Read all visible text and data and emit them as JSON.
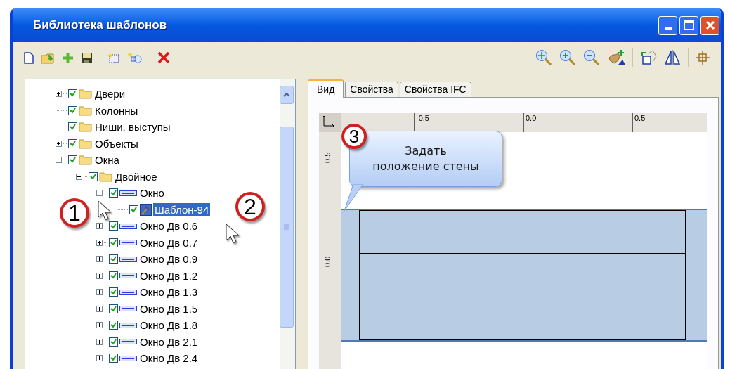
{
  "window": {
    "title": "Библиотека шаблонов"
  },
  "tree": [
    {
      "label": "Двери",
      "kind": "folder",
      "checked": true,
      "expanded": false,
      "selected": false
    },
    {
      "label": "Колонны",
      "kind": "folder",
      "checked": true,
      "selected": false
    },
    {
      "label": "Ниши, выступы",
      "kind": "folder",
      "checked": true,
      "selected": false
    },
    {
      "label": "Объекты",
      "kind": "folder",
      "checked": true,
      "expanded": false,
      "selected": false
    },
    {
      "label": "Окна",
      "kind": "folder",
      "checked": true,
      "expanded": true,
      "selected": false,
      "children": [
        {
          "label": "Двойное",
          "kind": "folder",
          "checked": true,
          "expanded": true,
          "selected": false,
          "children": [
            {
              "label": "Окно",
              "kind": "window",
              "checked": true,
              "expanded": true,
              "selected": false,
              "children": [
                {
                  "label": "Шаблон-94",
                  "kind": "template",
                  "checked": true,
                  "selected": true
                }
              ]
            },
            {
              "label": "Окно Дв 0.6",
              "kind": "window",
              "checked": true,
              "expanded": false,
              "selected": false
            },
            {
              "label": "Окно Дв 0.7",
              "kind": "window",
              "checked": true,
              "expanded": false,
              "selected": false
            },
            {
              "label": "Окно Дв 0.9",
              "kind": "window",
              "checked": true,
              "expanded": false,
              "selected": false
            },
            {
              "label": "Окно Дв 1.2",
              "kind": "window",
              "checked": true,
              "expanded": false,
              "selected": false
            },
            {
              "label": "Окно Дв 1.3",
              "kind": "window",
              "checked": true,
              "expanded": false,
              "selected": false
            },
            {
              "label": "Окно Дв 1.5",
              "kind": "window",
              "checked": true,
              "expanded": false,
              "selected": false
            },
            {
              "label": "Окно Дв 1.8",
              "kind": "window",
              "checked": true,
              "expanded": false,
              "selected": false
            },
            {
              "label": "Окно Дв 2.1",
              "kind": "window",
              "checked": true,
              "expanded": false,
              "selected": false
            },
            {
              "label": "Окно Дв 2.4",
              "kind": "window",
              "checked": true,
              "expanded": false,
              "selected": false
            }
          ]
        }
      ]
    }
  ],
  "tabs": [
    {
      "label": "Вид",
      "selected": true
    },
    {
      "label": "Свойства",
      "selected": false
    },
    {
      "label": "Свойства IFC",
      "selected": false
    }
  ],
  "ruler": {
    "x_labels": [
      "-0.5",
      "0.0",
      "0.5"
    ],
    "y_labels": [
      "0.5",
      "0.0"
    ]
  },
  "callouts": [
    {
      "number": "1"
    },
    {
      "number": "2"
    },
    {
      "number": "3",
      "text": "Задать\nположение стены"
    }
  ]
}
